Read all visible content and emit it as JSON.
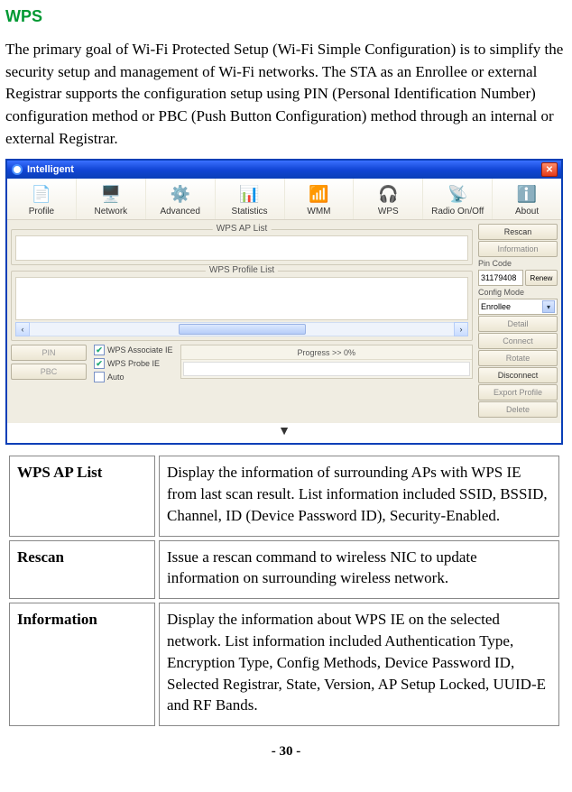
{
  "page": {
    "section_title": "WPS",
    "intro": "The primary goal of Wi-Fi Protected Setup (Wi-Fi Simple Configuration) is to simplify the security setup and management of Wi-Fi networks. The STA as an Enrollee or external Registrar supports the configuration setup using PIN (Personal Identification Number) configuration method or PBC (Push Button Configuration) method through an internal or external Registrar.",
    "footer": "- 30 -"
  },
  "window": {
    "title": "Intelligent",
    "tabs": {
      "profile": "Profile",
      "network": "Network",
      "advanced": "Advanced",
      "statistics": "Statistics",
      "wmm": "WMM",
      "wps": "WPS",
      "radio": "Radio On/Off",
      "about": "About"
    },
    "group": {
      "ap_list": "WPS AP List",
      "profile_list": "WPS Profile List"
    },
    "side": {
      "rescan": "Rescan",
      "information": "Information",
      "pin_code_label": "Pin Code",
      "pin_value": "31179408",
      "renew": "Renew",
      "config_mode_label": "Config Mode",
      "config_mode_value": "Enrollee",
      "detail": "Detail",
      "connect": "Connect",
      "rotate": "Rotate",
      "disconnect": "Disconnect",
      "export_profile": "Export Profile",
      "delete": "Delete"
    },
    "bottom": {
      "pin_btn": "PIN",
      "pbc_btn": "PBC",
      "cb_associate": "WPS Associate IE",
      "cb_probe": "WPS Probe IE",
      "cb_auto": "Auto",
      "progress": "Progress >> 0%"
    }
  },
  "definitions": [
    {
      "term": "WPS AP List",
      "desc": "Display the information of surrounding APs with WPS IE from last scan result. List information included SSID, BSSID, Channel, ID (Device Password ID), Security-Enabled."
    },
    {
      "term": "Rescan",
      "desc": "Issue a rescan command to wireless NIC to update information on surrounding wireless network."
    },
    {
      "term": "Information",
      "desc": "Display the information about WPS IE on the selected network. List information included Authentication Type, Encryption Type, Config Methods, Device Password ID, Selected Registrar, State, Version, AP Setup Locked, UUID-E and RF Bands."
    }
  ]
}
